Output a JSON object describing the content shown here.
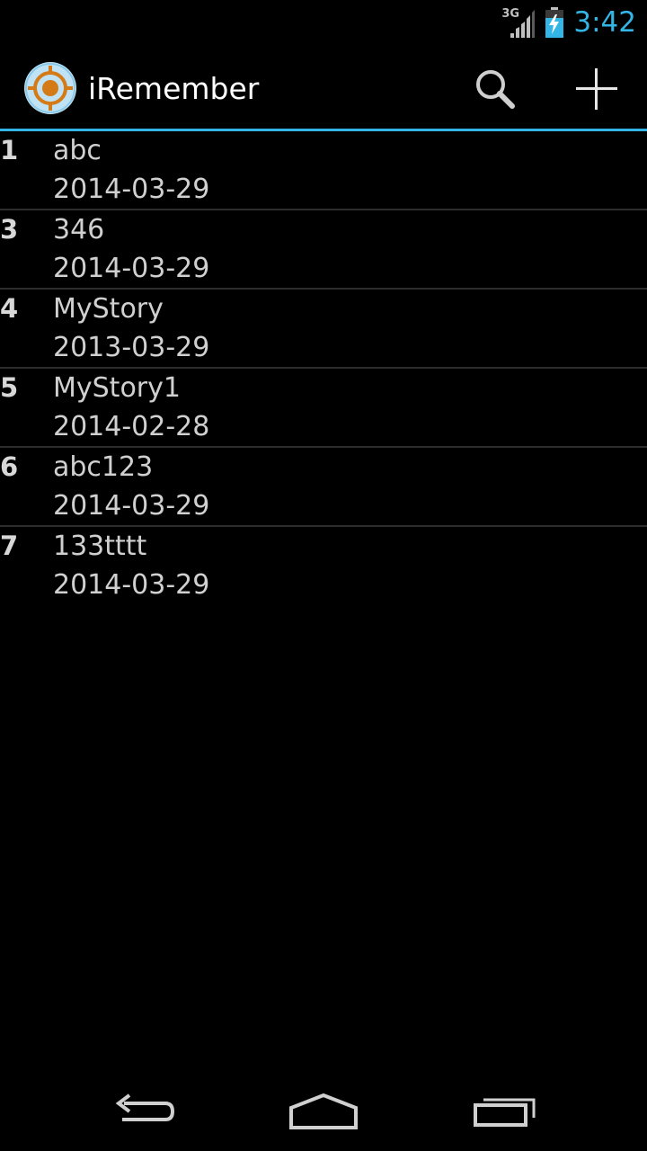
{
  "status_bar": {
    "network_type": "3G",
    "time": "3:42",
    "icons": [
      "signal-icon",
      "battery-charging-icon"
    ]
  },
  "action_bar": {
    "app_icon": "target-icon",
    "title": "iRemember",
    "actions": [
      {
        "name": "search",
        "icon": "search-icon"
      },
      {
        "name": "add",
        "icon": "plus-icon"
      }
    ]
  },
  "list": {
    "items": [
      {
        "id": "1",
        "title": "abc",
        "date": "2014-03-29"
      },
      {
        "id": "3",
        "title": "346",
        "date": "2014-03-29"
      },
      {
        "id": "4",
        "title": "MyStory",
        "date": "2013-03-29"
      },
      {
        "id": "5",
        "title": "MyStory1",
        "date": "2014-02-28"
      },
      {
        "id": "6",
        "title": "abc123",
        "date": "2014-03-29"
      },
      {
        "id": "7",
        "title": "133tttt",
        "date": "2014-03-29"
      }
    ]
  },
  "nav_bar": {
    "buttons": [
      "back-icon",
      "home-icon",
      "recent-apps-icon"
    ]
  },
  "colors": {
    "accent": "#33b5e5",
    "background": "#000000",
    "text": "#d0d0d0",
    "app_icon_ring": "#d47a16",
    "app_icon_bg": "#bfe3f5"
  }
}
